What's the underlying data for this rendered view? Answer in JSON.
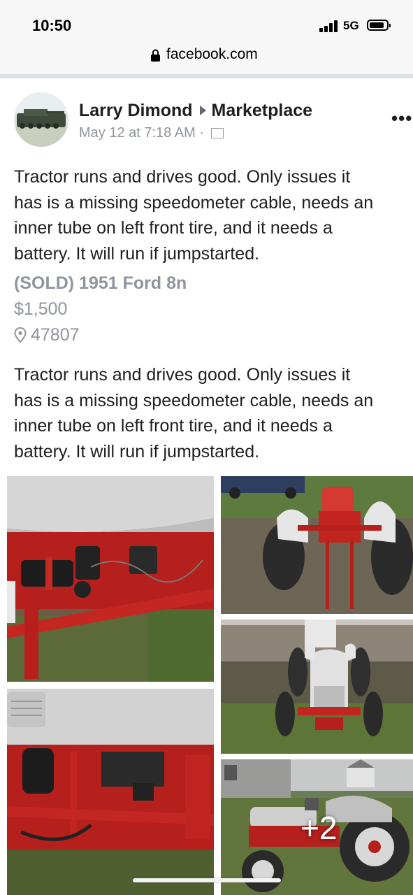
{
  "status_bar": {
    "time": "10:50",
    "network": "5G"
  },
  "browser": {
    "url": "facebook.com"
  },
  "post": {
    "author": "Larry Dimond",
    "destination": "Marketplace",
    "timestamp": "May 12 at 7:18 AM ·",
    "more_icon": "more-horizontal-icon",
    "description_lines": [
      "Tractor runs and drives good. Only issues it",
      "has is a missing speedometer cable, needs an",
      "inner tube on left front tire, and it needs a",
      "battery. It will run if jumpstarted."
    ]
  },
  "listing": {
    "title": "(SOLD) 1951 Ford 8n",
    "price": "$1,500",
    "location": "47807",
    "description_lines": [
      "Tractor runs and drives good. Only issues it",
      "has is a missing speedometer cable, needs an",
      "inner tube on left front tire, and it needs a",
      "battery. It will run if jumpstarted."
    ]
  },
  "gallery": {
    "more_count": "+2"
  },
  "colors": {
    "tractor_red": "#b8211f",
    "tractor_gray": "#d9d9d9",
    "meta_gray": "#90949c"
  }
}
